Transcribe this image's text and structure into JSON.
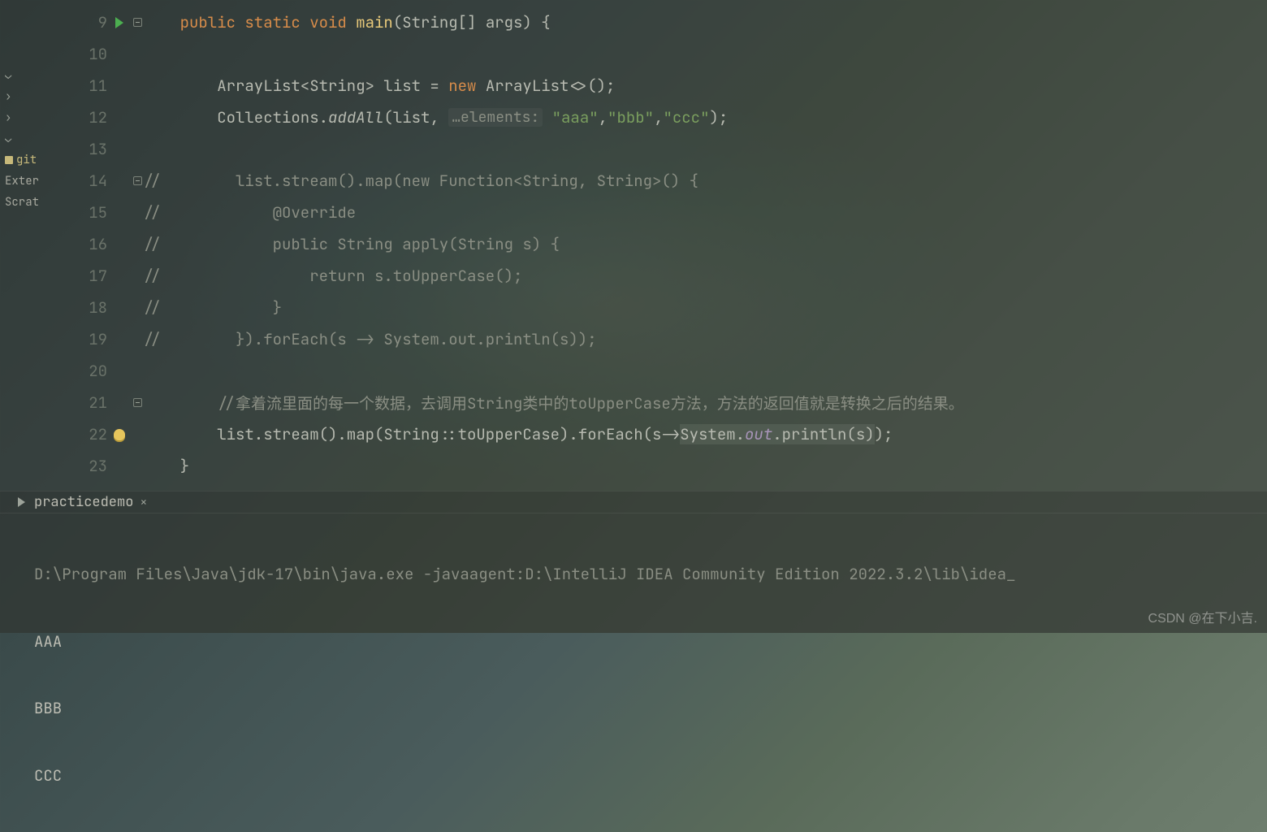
{
  "watermark": "CSDN @在下小吉.",
  "sidebar": {
    "gitignore_label": "git",
    "external_label": "Exter",
    "scratches_label": "Scrat"
  },
  "gutter": {
    "lines": [
      "9",
      "10",
      "11",
      "12",
      "13",
      "14",
      "15",
      "16",
      "17",
      "18",
      "19",
      "20",
      "21",
      "22",
      "23"
    ]
  },
  "code": {
    "l9": {
      "indent": "    ",
      "kw": "public static void ",
      "name": "main",
      "paren": "(",
      "args": "String[] args) {"
    },
    "l10": "",
    "l11": {
      "indent": "        ",
      "pre": "ArrayList<String> list = ",
      "new": "new ",
      "post": "ArrayList<>();"
    },
    "l12": {
      "indent": "        ",
      "pre": "Collections.",
      "addall": "addAll",
      "paren": "(list, ",
      "hint": "…elements:",
      "s1": " \"aaa\"",
      "c1": ",",
      "s2": "\"bbb\"",
      "c2": ",",
      "s3": "\"ccc\"",
      "end": ");"
    },
    "l13": "",
    "l14": "//        list.stream().map(new Function<String, String>() {",
    "l15": "//            @Override",
    "l16": "//            public String apply(String s) {",
    "l17": "//                return s.toUpperCase();",
    "l18": "//            }",
    "l19": "//        }).forEach(s -> System.out.println(s));",
    "l20": "",
    "l21": "        //拿着流里面的每一个数据，去调用String类中的toUpperCase方法，方法的返回值就是转换之后的结果。",
    "l22": {
      "indent": "        ",
      "pre": "list.stream().map(String::toUpperCase).forEach(",
      "lambda": "s->",
      "sys": "System.",
      "out": "out",
      "println": ".println(s)",
      "close": ");"
    },
    "l23": "    }"
  },
  "console": {
    "tab_name": "practicedemo",
    "truncated_header": "D:\\Program Files\\Java\\jdk-17\\bin\\java.exe    -javaagent:D:\\IntelliJ IDEA Community Edition 2022.3.2\\lib\\idea_",
    "output": [
      "AAA",
      "BBB",
      "CCC"
    ]
  }
}
